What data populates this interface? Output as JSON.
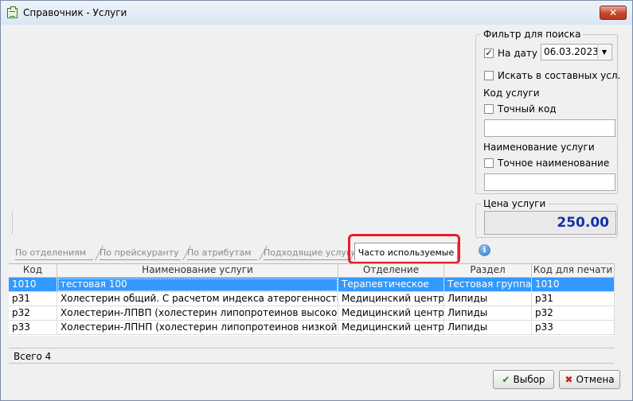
{
  "window": {
    "title": "Справочник - Услуги",
    "close_glyph": "✕"
  },
  "filter": {
    "legend": "Фильтр для поиска",
    "on_date_label": "На дату",
    "on_date_checked": true,
    "date_value": "06.03.2023",
    "search_composite_label": "Искать в составных усл.",
    "search_composite_checked": false,
    "code_section_label": "Код услуги",
    "exact_code_label": "Точный код",
    "exact_code_checked": false,
    "code_value": "",
    "name_section_label": "Наименование услуги",
    "exact_name_label": "Точное наименование",
    "exact_name_checked": false,
    "name_value": ""
  },
  "price": {
    "legend": "Цена услуги",
    "value": "250.00",
    "color": "#1530a8"
  },
  "tabs": [
    {
      "label": "По отделениям",
      "active": false
    },
    {
      "label": "По прейскуранту",
      "active": false
    },
    {
      "label": "По атрибутам",
      "active": false
    },
    {
      "label": "Подходящие услуги",
      "active": false
    },
    {
      "label": "Часто используемые",
      "active": true
    }
  ],
  "icons": {
    "info": "info-icon",
    "check": "✔",
    "cross": "✖"
  },
  "table": {
    "columns": [
      "Код",
      "Наименование услуги",
      "Отделение",
      "Раздел",
      "Код для печати"
    ],
    "rows": [
      [
        "1010",
        "тестовая 100",
        "Терапевтическое",
        "Тестовая группа",
        "1010"
      ],
      [
        "p31",
        "Холестерин общий. С расчетом индекса атерогенности ...",
        "Медицинский центр",
        "Липиды",
        "p31"
      ],
      [
        "p32",
        "Холестерин-ЛПВП (холестерин липопротеинов высокой...",
        "Медицинский центр",
        "Липиды",
        "p32"
      ],
      [
        "p33",
        "Холестерин-ЛПНП (холестерин липопротеинов низкой п...",
        "Медицинский центр",
        "Липиды",
        "p33"
      ]
    ],
    "selected_row": 0
  },
  "footer": {
    "total": "Всего 4"
  },
  "buttons": {
    "select": "Выбор",
    "cancel": "Отмена"
  },
  "colors": {
    "selection": "#3399ff",
    "highlight": "#e3202b"
  }
}
